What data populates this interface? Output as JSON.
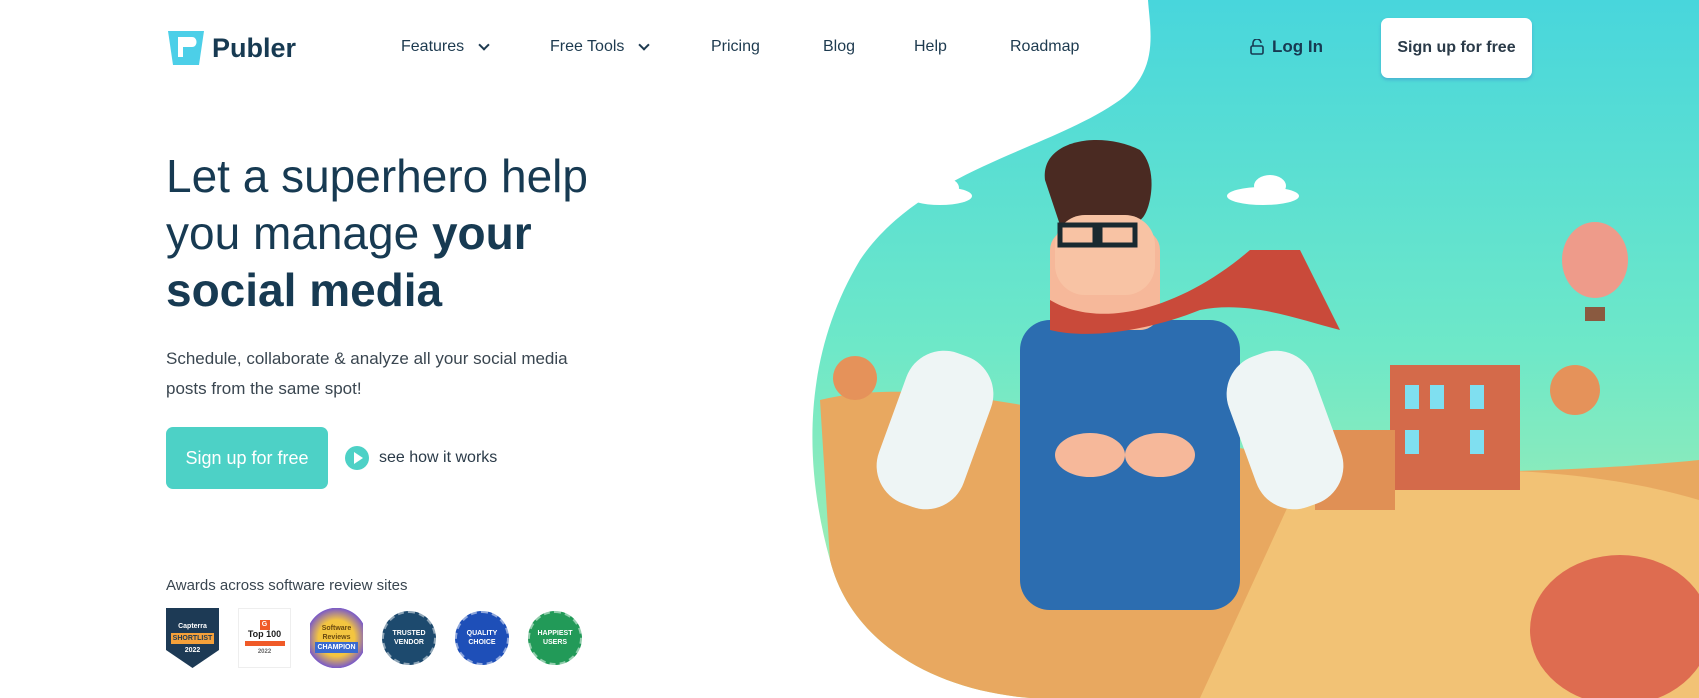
{
  "brand": {
    "name": "Publer",
    "accent": "#4dd1c6",
    "dark": "#173a52"
  },
  "nav": {
    "items": [
      {
        "label": "Features",
        "dropdown": true
      },
      {
        "label": "Free Tools",
        "dropdown": true
      },
      {
        "label": "Pricing"
      },
      {
        "label": "Blog"
      },
      {
        "label": "Help"
      },
      {
        "label": "Roadmap"
      }
    ],
    "login": "Log In",
    "signup": "Sign up for free"
  },
  "hero": {
    "title_line1": "Let a superhero help",
    "title_line2a": "you manage ",
    "title_line2b": "your",
    "title_line3": "social media",
    "subtitle": "Schedule, collaborate & analyze all your social media posts from the same spot!",
    "cta": "Sign up for free",
    "how": "see how it works"
  },
  "awards": {
    "label": "Awards across software review sites",
    "badges": [
      {
        "l1": "Capterra",
        "l2": "SHORTLIST",
        "l3": "2022"
      },
      {
        "l1": "Top 100",
        "l2": "2022"
      },
      {
        "l1": "Software Reviews",
        "l2": "CHAMPION"
      },
      {
        "l1": "TRUSTED",
        "l2": "VENDOR",
        "color": "#1d4a6e"
      },
      {
        "l1": "QUALITY",
        "l2": "CHOICE",
        "color": "#1e4fb8"
      },
      {
        "l1": "HAPPIEST",
        "l2": "USERS",
        "color": "#229a58"
      }
    ]
  }
}
